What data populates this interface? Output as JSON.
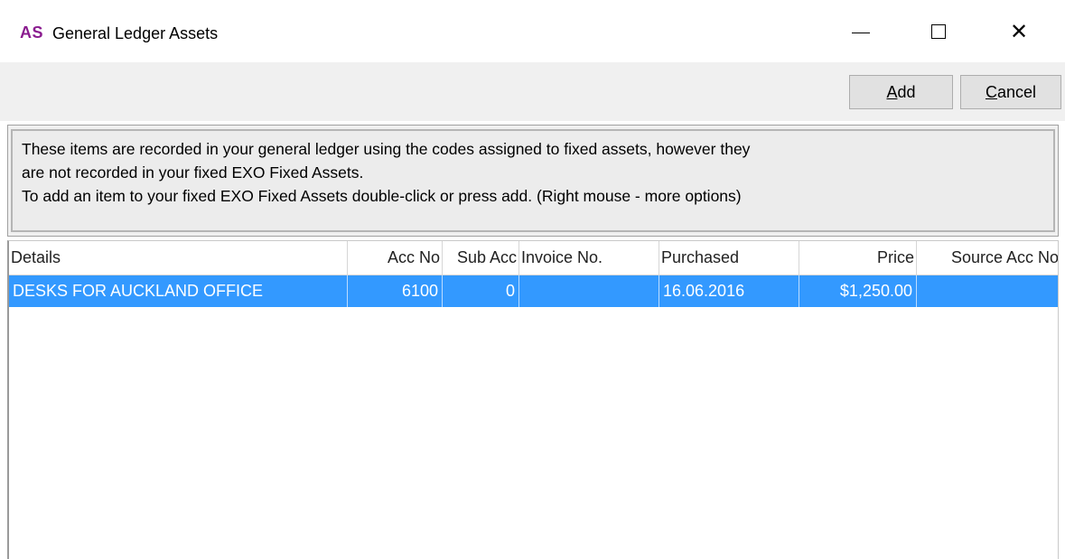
{
  "window": {
    "logo_text": "AS",
    "title": "General Ledger Assets",
    "controls": {
      "minimize_icon": "minimize-icon",
      "maximize_icon": "maximize-icon",
      "close_icon": "close-icon",
      "close_glyph": "✕"
    }
  },
  "toolbar": {
    "add_label_access_key": "A",
    "add_label_rest": "dd",
    "cancel_label_access_key": "C",
    "cancel_label_rest": "ancel"
  },
  "info": {
    "lines": [
      "These items are recorded in your general ledger using the codes assigned to fixed assets, however they",
      "are not recorded in your fixed EXO Fixed Assets.",
      "To add an item to your fixed EXO Fixed Assets double-click or press add. (Right mouse - more options)"
    ]
  },
  "grid": {
    "columns": [
      "Details",
      "Acc No",
      "Sub Acc",
      "Invoice No.",
      "Purchased",
      "Price",
      "Source Acc No"
    ],
    "rows": [
      {
        "details": "DESKS FOR AUCKLAND OFFICE",
        "acc_no": "6100",
        "sub_acc": "0",
        "invoice_no": "",
        "purchased": "16.06.2016",
        "price": "$1,250.00",
        "source_acc_no": ""
      }
    ],
    "selected_row_color": "#3399ff"
  },
  "colors": {
    "logo": "#8a1c8f",
    "toolbar_bg": "#f0f0f0"
  }
}
